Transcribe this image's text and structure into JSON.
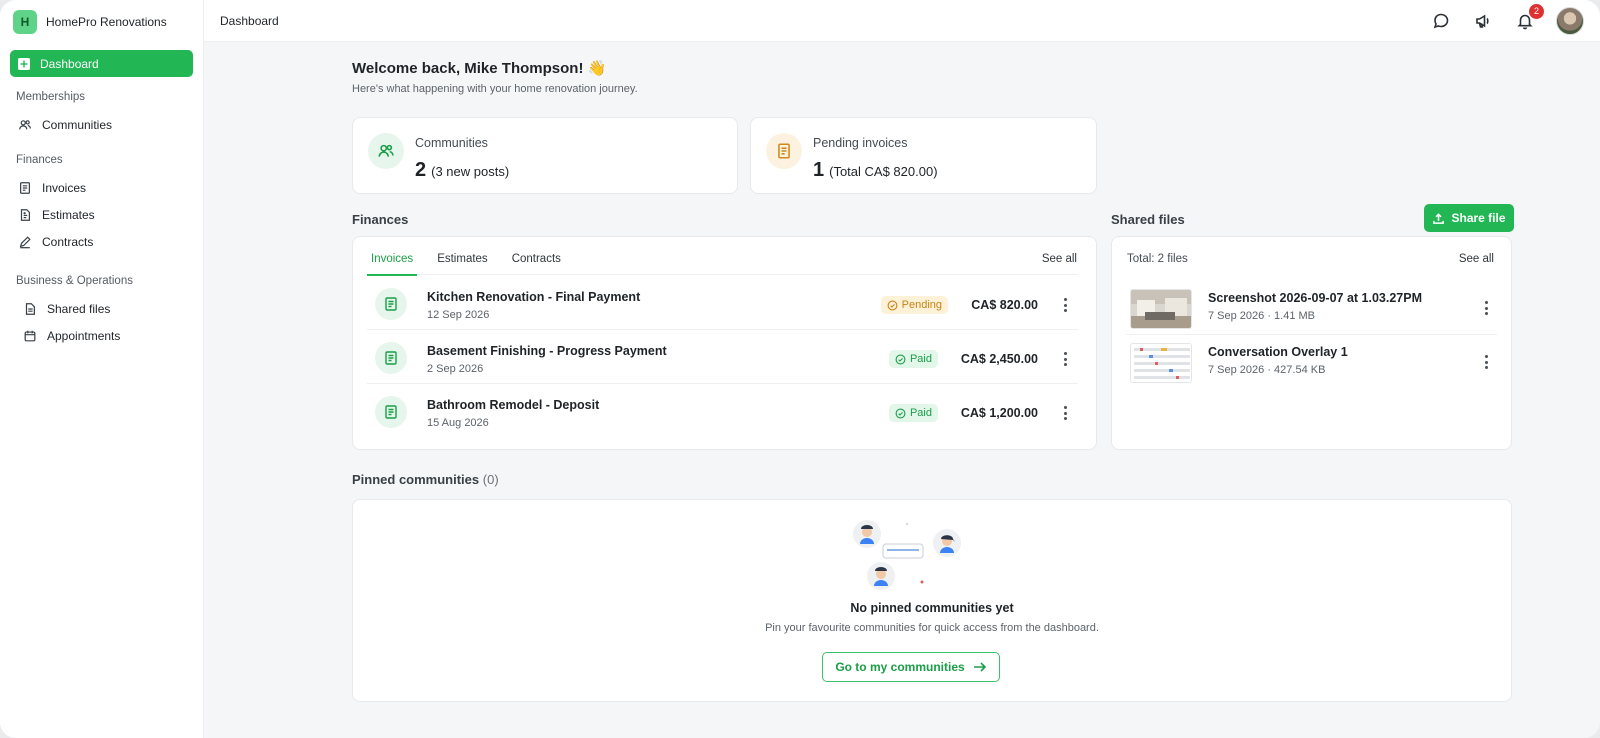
{
  "brand": {
    "logo_letter": "H",
    "name": "HomePro Renovations"
  },
  "sidebar": {
    "active": {
      "label": "Dashboard"
    },
    "sections": [
      {
        "title": "Memberships",
        "items": [
          {
            "label": "Communities",
            "icon": "users-icon"
          }
        ]
      },
      {
        "title": "Finances",
        "items": [
          {
            "label": "Invoices",
            "icon": "invoice-icon"
          },
          {
            "label": "Estimates",
            "icon": "estimate-icon"
          },
          {
            "label": "Contracts",
            "icon": "pen-icon"
          }
        ]
      },
      {
        "title": "Business & Operations",
        "items": [
          {
            "label": "Shared files",
            "icon": "file-icon"
          },
          {
            "label": "Appointments",
            "icon": "calendar-icon"
          }
        ]
      }
    ]
  },
  "topbar": {
    "title": "Dashboard",
    "notifications_count": "2"
  },
  "welcome": {
    "title": "Welcome back, Mike Thompson! 👋",
    "subtitle": "Here's what happening with your home renovation journey."
  },
  "stats": [
    {
      "label": "Communities",
      "value": "2",
      "detail": "(3 new posts)"
    },
    {
      "label": "Pending invoices",
      "value": "1",
      "detail": "(Total CA$ 820.00)"
    }
  ],
  "finances": {
    "title": "Finances",
    "tabs": [
      "Invoices",
      "Estimates",
      "Contracts"
    ],
    "see_all": "See all",
    "invoices": [
      {
        "title": "Kitchen Renovation - Final Payment",
        "date": "12 Sep 2026",
        "status": "Pending",
        "amount": "CA$ 820.00"
      },
      {
        "title": "Basement Finishing - Progress Payment",
        "date": "2 Sep 2026",
        "status": "Paid",
        "amount": "CA$ 2,450.00"
      },
      {
        "title": "Bathroom Remodel - Deposit",
        "date": "15 Aug 2026",
        "status": "Paid",
        "amount": "CA$ 1,200.00"
      }
    ]
  },
  "shared_files": {
    "title": "Shared files",
    "share_button": "Share file",
    "total": "Total: 2 files",
    "see_all": "See all",
    "files": [
      {
        "name": "Screenshot 2026-09-07 at 1.03.27PM",
        "meta": "7 Sep 2026 · 1.41 MB"
      },
      {
        "name": "Conversation Overlay 1",
        "meta": "7 Sep 2026 · 427.54 KB"
      }
    ]
  },
  "pinned": {
    "title": "Pinned communities",
    "count": "(0)",
    "empty_title": "No pinned communities yet",
    "empty_subtitle": "Pin your favourite communities for quick access from the dashboard.",
    "button": "Go to my communities"
  },
  "colors": {
    "accent": "#22b655",
    "pending": "#c88514",
    "notification": "#e03131"
  }
}
